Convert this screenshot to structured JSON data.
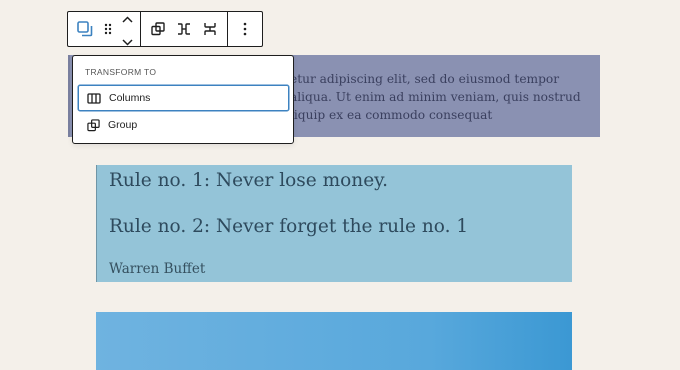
{
  "toolbar": {
    "buttons": [
      {
        "icon": "block-type-icon"
      },
      {
        "icon": "drag-handle-icon"
      },
      {
        "icon": "move-up-icon"
      },
      {
        "icon": "move-down-icon"
      },
      {
        "icon": "group-icon"
      },
      {
        "icon": "row-icon"
      },
      {
        "icon": "stack-icon"
      },
      {
        "icon": "more-options-icon"
      }
    ]
  },
  "transform_menu": {
    "heading": "TRANSFORM TO",
    "items": [
      {
        "label": "Columns",
        "icon": "columns-icon",
        "selected": true
      },
      {
        "label": "Group",
        "icon": "group-icon",
        "selected": false
      }
    ]
  },
  "paragraph": {
    "lines": [
      "etur adipiscing elit, sed do eiusmod tempor",
      "aliqua. Ut enim ad minim veniam, quis nostrud",
      "liquip ex ea commodo consequat"
    ]
  },
  "quote": {
    "line1": "Rule no. 1: Never lose money.",
    "line2": "Rule no. 2: Never forget the rule no. 1",
    "citation": "Warren Buffet"
  },
  "colors": {
    "background": "#f4f0ea",
    "paragraph_bg": "#8a91b2",
    "quote_bg": "#94c4d8",
    "cover_gradient_start": "#6fb3e0",
    "cover_gradient_end": "#3b98d3",
    "accent": "#3c82c0"
  }
}
